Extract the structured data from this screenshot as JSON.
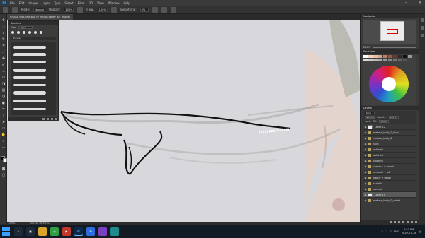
{
  "app": {
    "logo": "Ps"
  },
  "menu": [
    "File",
    "Edit",
    "Image",
    "Layer",
    "Type",
    "Select",
    "Filter",
    "3D",
    "View",
    "Window",
    "Help"
  ],
  "window_controls": [
    "–",
    "□",
    "×"
  ],
  "options_bar": {
    "mode_label": "Mode:",
    "mode_value": "Normal",
    "opacity_label": "Opacity:",
    "opacity_value": "100%",
    "flow_label": "Flow:",
    "flow_value": "100%",
    "smoothing_label": "Smoothing:",
    "smoothing_value": "0%"
  },
  "document_tab": {
    "title": "CHASE MELONA.psd @ 200% (Layer 10, RGB/8)"
  },
  "brush_panel": {
    "title": "Brushes",
    "size_label": "Size:",
    "size_value": "20 px",
    "group_name": "Brushes"
  },
  "navigator": {
    "title": "Navigator",
    "zoom": "200%"
  },
  "swatches": {
    "title": "Swatches"
  },
  "layers": {
    "title": "Layers",
    "filter_label": "Kind",
    "blend_mode": "Normal",
    "opacity_label": "Opacity:",
    "opacity_value": "100%",
    "lock_label": "Lock:",
    "fill_label": "Fill:",
    "fill_value": "100%",
    "items": [
      {
        "name": "Layer 12",
        "type": "layer"
      },
      {
        "name": "melona_body_2_lines",
        "type": "group"
      },
      {
        "name": "melona_body_2",
        "type": "group"
      },
      {
        "name": "shirt",
        "type": "group"
      },
      {
        "name": "outlined",
        "type": "group"
      },
      {
        "name": "outlined",
        "type": "group"
      },
      {
        "name": "coloring",
        "type": "group"
      },
      {
        "name": "cumeva + sound",
        "type": "group"
      },
      {
        "name": "semeval + sdf",
        "type": "group"
      },
      {
        "name": "happy + laugh",
        "type": "group"
      },
      {
        "name": "scribble",
        "type": "group"
      },
      {
        "name": "normal",
        "type": "group"
      },
      {
        "name": "Layer 10",
        "type": "layer",
        "active": true
      },
      {
        "name": "melona_body_2_noted",
        "type": "group"
      }
    ]
  },
  "status_bar": {
    "zoom": "200%",
    "doc": "Doc: 26.3M/2.73G"
  },
  "taskbar": {
    "apps": [
      {
        "icon": "search-icon",
        "label": ""
      },
      {
        "icon": "task-view-icon",
        "label": ""
      },
      {
        "icon": "folder-icon",
        "label": ""
      },
      {
        "icon": "chrome-icon",
        "label": ""
      },
      {
        "icon": "media-icon",
        "label": ""
      },
      {
        "icon": "photoshop-icon",
        "label": "Ps"
      },
      {
        "icon": "settings-icon",
        "label": ""
      },
      {
        "icon": "app-icon",
        "label": ""
      },
      {
        "icon": "app-icon",
        "label": ""
      }
    ],
    "tray_lang": "ENG",
    "time": "5:51 PM",
    "date": "2020-07-18"
  }
}
